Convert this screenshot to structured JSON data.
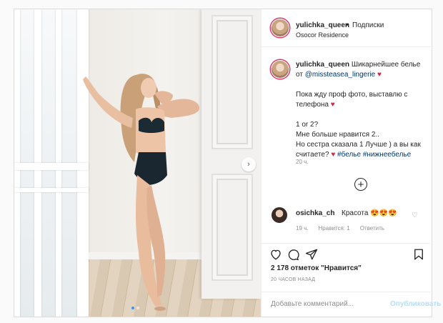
{
  "post": {
    "username": "yulichka_queen",
    "separator": "•",
    "follow_label": "Подписки",
    "location": "Osocor Residence"
  },
  "caption": {
    "username": "yulichka_queen",
    "line1": "Шикарнейшее белье от",
    "mention": "@missteasea_lingerie",
    "line2": "Пока жду проф фото, выставлю с телефона",
    "line3": "1 or 2?",
    "line4": "Мне больше нравится 2..",
    "line5": "Но сестра сказала 1 Лучше ) а вы как считаете?",
    "hashtag1": "#белье",
    "hashtag2": "#нижнеебелье",
    "heart": "♥",
    "time": "20 ч."
  },
  "more_comments": {
    "label": "+"
  },
  "comment": {
    "username": "osichka_ch",
    "text": "Красота 😍😍😍",
    "time": "19 ч.",
    "likes": "Нравится: 1",
    "reply": "Ответить"
  },
  "stats": {
    "likes": "2 178 отметок \"Нравится\"",
    "time": "20 ЧАСОВ НАЗАД"
  },
  "composer": {
    "placeholder": "Добавьте комментарий...",
    "publish": "Опубликовать"
  },
  "carousel": {
    "next": "›",
    "slides": 2,
    "active_index": 0
  },
  "icons": [
    "heart-icon",
    "comment-icon",
    "share-icon",
    "bookmark-icon",
    "next-arrow-icon",
    "plus-circle-icon"
  ]
}
